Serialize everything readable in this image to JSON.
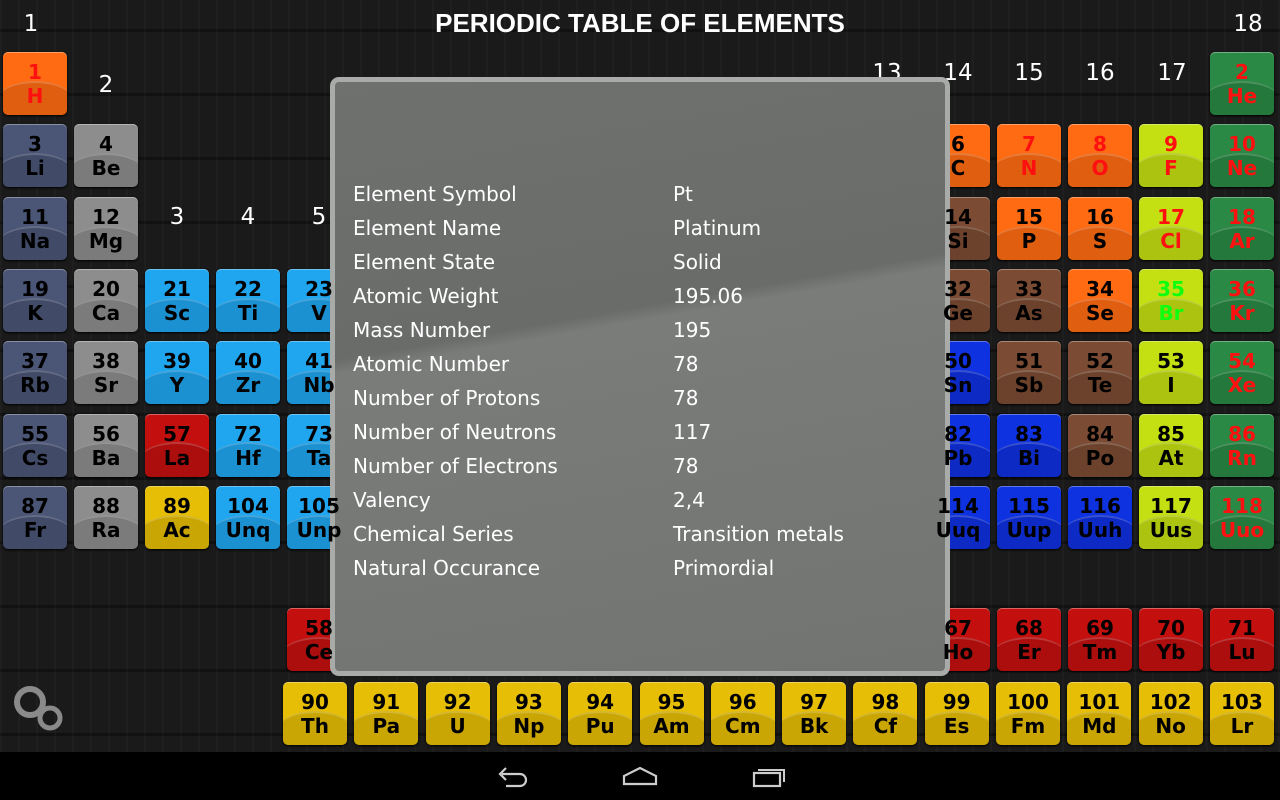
{
  "title": "PERIODIC TABLE OF ELEMENTS",
  "group_labels": [
    {
      "label": "1",
      "g": 1
    },
    {
      "label": "2",
      "g": 2
    },
    {
      "label": "3",
      "g": 3
    },
    {
      "label": "4",
      "g": 4
    },
    {
      "label": "5",
      "g": 5
    },
    {
      "label": "13",
      "g": 13
    },
    {
      "label": "14",
      "g": 14
    },
    {
      "label": "15",
      "g": 15
    },
    {
      "label": "16",
      "g": 16
    },
    {
      "label": "17",
      "g": 17
    },
    {
      "label": "18",
      "g": 18
    }
  ],
  "colors": {
    "nonmetal": "#ff6b12",
    "alkali": "#4b5677",
    "alkaline": "#8d8d8d",
    "transition": "#20a6ef",
    "lanthanide": "#c3100f",
    "actinide": "#e6be05",
    "metalloid": "#7b4c33",
    "poor": "#0f32e0",
    "halogen": "#c4e012",
    "noble": "#2a8944",
    "gas_text": "#ff1010",
    "liquid_text": "#10ff10",
    "solid_text": "#000000"
  },
  "elements": [
    {
      "n": "1",
      "s": "H",
      "t": "nonmetal",
      "group": 1,
      "period": 1,
      "state": "gas"
    },
    {
      "n": "2",
      "s": "He",
      "t": "noble",
      "group": 18,
      "period": 1,
      "state": "gas"
    },
    {
      "n": "3",
      "s": "Li",
      "t": "alkali",
      "group": 1,
      "period": 2
    },
    {
      "n": "4",
      "s": "Be",
      "t": "alkaline",
      "group": 2,
      "period": 2
    },
    {
      "n": "6",
      "s": "C",
      "t": "nonmetal",
      "group": 14,
      "period": 2
    },
    {
      "n": "7",
      "s": "N",
      "t": "nonmetal",
      "group": 15,
      "period": 2,
      "state": "gas"
    },
    {
      "n": "8",
      "s": "O",
      "t": "nonmetal",
      "group": 16,
      "period": 2,
      "state": "gas"
    },
    {
      "n": "9",
      "s": "F",
      "t": "halogen",
      "group": 17,
      "period": 2,
      "state": "gas"
    },
    {
      "n": "10",
      "s": "Ne",
      "t": "noble",
      "group": 18,
      "period": 2,
      "state": "gas"
    },
    {
      "n": "11",
      "s": "Na",
      "t": "alkali",
      "group": 1,
      "period": 3
    },
    {
      "n": "12",
      "s": "Mg",
      "t": "alkaline",
      "group": 2,
      "period": 3
    },
    {
      "n": "14",
      "s": "Si",
      "t": "metalloid",
      "group": 14,
      "period": 3
    },
    {
      "n": "15",
      "s": "P",
      "t": "nonmetal",
      "group": 15,
      "period": 3
    },
    {
      "n": "16",
      "s": "S",
      "t": "nonmetal",
      "group": 16,
      "period": 3
    },
    {
      "n": "17",
      "s": "Cl",
      "t": "halogen",
      "group": 17,
      "period": 3,
      "state": "gas"
    },
    {
      "n": "18",
      "s": "Ar",
      "t": "noble",
      "group": 18,
      "period": 3,
      "state": "gas"
    },
    {
      "n": "19",
      "s": "K",
      "t": "alkali",
      "group": 1,
      "period": 4
    },
    {
      "n": "20",
      "s": "Ca",
      "t": "alkaline",
      "group": 2,
      "period": 4
    },
    {
      "n": "21",
      "s": "Sc",
      "t": "transition",
      "group": 3,
      "period": 4
    },
    {
      "n": "22",
      "s": "Ti",
      "t": "transition",
      "group": 4,
      "period": 4
    },
    {
      "n": "23",
      "s": "V",
      "t": "transition",
      "group": 5,
      "period": 4
    },
    {
      "n": "32",
      "s": "Ge",
      "t": "metalloid",
      "group": 14,
      "period": 4
    },
    {
      "n": "33",
      "s": "As",
      "t": "metalloid",
      "group": 15,
      "period": 4
    },
    {
      "n": "34",
      "s": "Se",
      "t": "nonmetal",
      "group": 16,
      "period": 4
    },
    {
      "n": "35",
      "s": "Br",
      "t": "halogen",
      "group": 17,
      "period": 4,
      "state": "liquid"
    },
    {
      "n": "36",
      "s": "Kr",
      "t": "noble",
      "group": 18,
      "period": 4,
      "state": "gas"
    },
    {
      "n": "37",
      "s": "Rb",
      "t": "alkali",
      "group": 1,
      "period": 5
    },
    {
      "n": "38",
      "s": "Sr",
      "t": "alkaline",
      "group": 2,
      "period": 5
    },
    {
      "n": "39",
      "s": "Y",
      "t": "transition",
      "group": 3,
      "period": 5
    },
    {
      "n": "40",
      "s": "Zr",
      "t": "transition",
      "group": 4,
      "period": 5
    },
    {
      "n": "41",
      "s": "Nb",
      "t": "transition",
      "group": 5,
      "period": 5
    },
    {
      "n": "50",
      "s": "Sn",
      "t": "poor",
      "group": 14,
      "period": 5
    },
    {
      "n": "51",
      "s": "Sb",
      "t": "metalloid",
      "group": 15,
      "period": 5
    },
    {
      "n": "52",
      "s": "Te",
      "t": "metalloid",
      "group": 16,
      "period": 5
    },
    {
      "n": "53",
      "s": "I",
      "t": "halogen",
      "group": 17,
      "period": 5
    },
    {
      "n": "54",
      "s": "Xe",
      "t": "noble",
      "group": 18,
      "period": 5,
      "state": "gas"
    },
    {
      "n": "55",
      "s": "Cs",
      "t": "alkali",
      "group": 1,
      "period": 6
    },
    {
      "n": "56",
      "s": "Ba",
      "t": "alkaline",
      "group": 2,
      "period": 6
    },
    {
      "n": "57",
      "s": "La",
      "t": "lanthanide",
      "group": 3,
      "period": 6
    },
    {
      "n": "72",
      "s": "Hf",
      "t": "transition",
      "group": 4,
      "period": 6
    },
    {
      "n": "73",
      "s": "Ta",
      "t": "transition",
      "group": 5,
      "period": 6
    },
    {
      "n": "82",
      "s": "Pb",
      "t": "poor",
      "group": 14,
      "period": 6
    },
    {
      "n": "83",
      "s": "Bi",
      "t": "poor",
      "group": 15,
      "period": 6
    },
    {
      "n": "84",
      "s": "Po",
      "t": "metalloid",
      "group": 16,
      "period": 6
    },
    {
      "n": "85",
      "s": "At",
      "t": "halogen",
      "group": 17,
      "period": 6
    },
    {
      "n": "86",
      "s": "Rn",
      "t": "noble",
      "group": 18,
      "period": 6,
      "state": "gas"
    },
    {
      "n": "87",
      "s": "Fr",
      "t": "alkali",
      "group": 1,
      "period": 7
    },
    {
      "n": "88",
      "s": "Ra",
      "t": "alkaline",
      "group": 2,
      "period": 7
    },
    {
      "n": "89",
      "s": "Ac",
      "t": "actinide",
      "group": 3,
      "period": 7
    },
    {
      "n": "104",
      "s": "Unq",
      "t": "transition",
      "group": 4,
      "period": 7
    },
    {
      "n": "105",
      "s": "Unp",
      "t": "transition",
      "group": 5,
      "period": 7
    },
    {
      "n": "114",
      "s": "Uuq",
      "t": "poor",
      "group": 14,
      "period": 7
    },
    {
      "n": "115",
      "s": "Uup",
      "t": "poor",
      "group": 15,
      "period": 7
    },
    {
      "n": "116",
      "s": "Uuh",
      "t": "poor",
      "group": 16,
      "period": 7
    },
    {
      "n": "117",
      "s": "Uus",
      "t": "halogen",
      "group": 17,
      "period": 7
    },
    {
      "n": "118",
      "s": "Uuo",
      "t": "noble",
      "group": 18,
      "period": 7,
      "state": "gas"
    }
  ],
  "lanthanides": [
    {
      "n": "58",
      "s": "Ce"
    },
    {
      "n": "67",
      "s": "Ho"
    },
    {
      "n": "68",
      "s": "Er"
    },
    {
      "n": "69",
      "s": "Tm"
    },
    {
      "n": "70",
      "s": "Yb"
    },
    {
      "n": "71",
      "s": "Lu"
    }
  ],
  "actinides": [
    {
      "n": "90",
      "s": "Th"
    },
    {
      "n": "91",
      "s": "Pa"
    },
    {
      "n": "92",
      "s": "U"
    },
    {
      "n": "93",
      "s": "Np"
    },
    {
      "n": "94",
      "s": "Pu"
    },
    {
      "n": "95",
      "s": "Am"
    },
    {
      "n": "96",
      "s": "Cm"
    },
    {
      "n": "97",
      "s": "Bk"
    },
    {
      "n": "98",
      "s": "Cf"
    },
    {
      "n": "99",
      "s": "Es"
    },
    {
      "n": "100",
      "s": "Fm"
    },
    {
      "n": "101",
      "s": "Md"
    },
    {
      "n": "102",
      "s": "No"
    },
    {
      "n": "103",
      "s": "Lr"
    }
  ],
  "details": [
    {
      "label": "Element Symbol",
      "value": "Pt"
    },
    {
      "label": "Element Name",
      "value": "Platinum"
    },
    {
      "label": "Element State",
      "value": "Solid"
    },
    {
      "label": "Atomic Weight",
      "value": "195.06"
    },
    {
      "label": "Mass Number",
      "value": "195"
    },
    {
      "label": "Atomic Number",
      "value": "78"
    },
    {
      "label": "Number of Protons",
      "value": "78"
    },
    {
      "label": "Number of Neutrons",
      "value": "117"
    },
    {
      "label": "Number of Electrons",
      "value": "78"
    },
    {
      "label": "Valency",
      "value": "2,4"
    },
    {
      "label": "Chemical Series",
      "value": "Transition metals"
    },
    {
      "label": "Natural Occurance",
      "value": "Primordial"
    }
  ],
  "nav": {
    "back": "back-icon",
    "home": "home-icon",
    "recents": "recents-icon"
  },
  "settings_icon": "gears-icon"
}
